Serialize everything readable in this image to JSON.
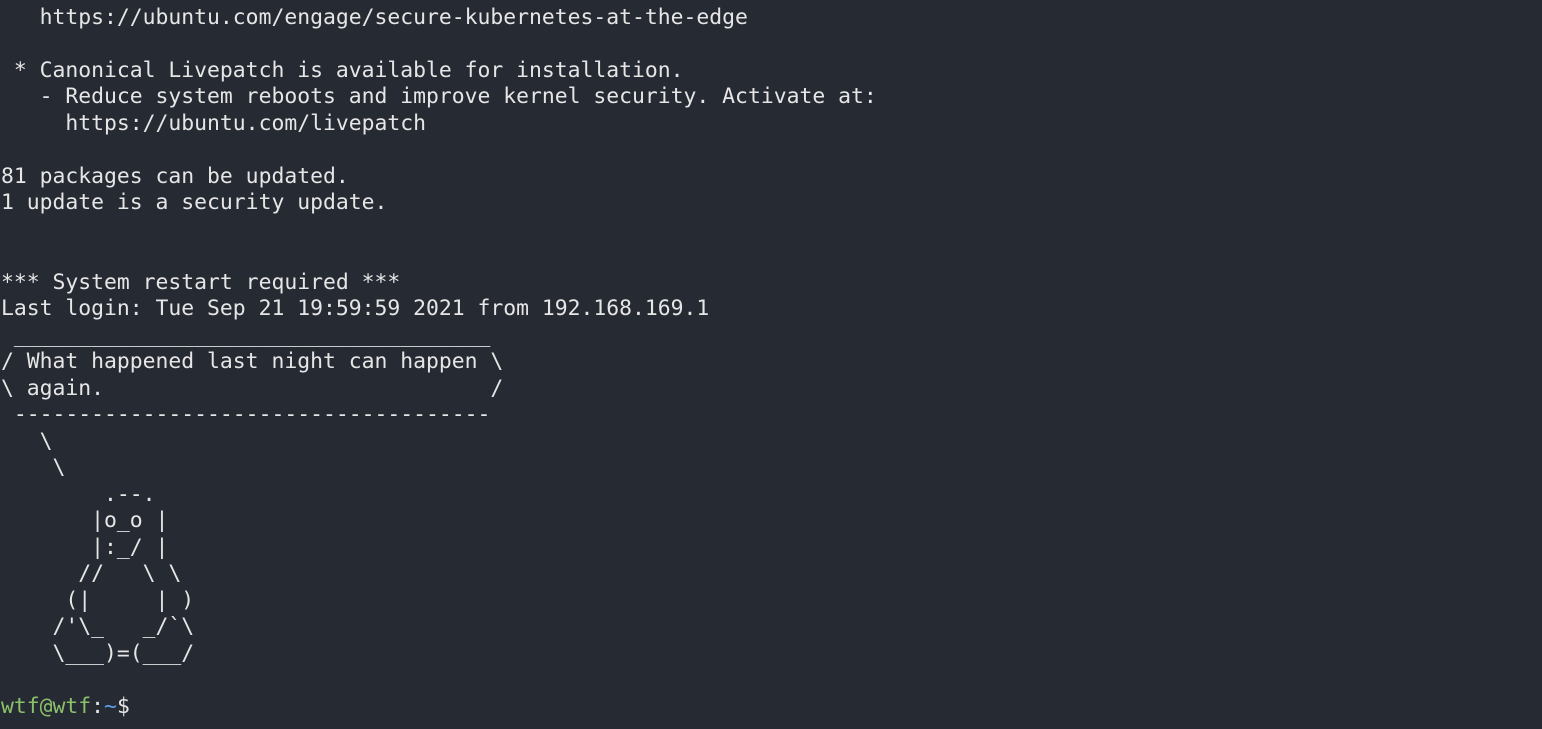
{
  "terminal": {
    "lines": [
      "   https://ubuntu.com/engage/secure-kubernetes-at-the-edge",
      "",
      " * Canonical Livepatch is available for installation.",
      "   - Reduce system reboots and improve kernel security. Activate at:",
      "     https://ubuntu.com/livepatch",
      "",
      "81 packages can be updated.",
      "1 update is a security update.",
      "",
      "",
      "*** System restart required ***",
      "Last login: Tue Sep 21 19:59:59 2021 from 192.168.169.1",
      " _____________________________________",
      "/ What happened last night can happen \\",
      "\\ again.                              /",
      " -------------------------------------",
      "   \\",
      "    \\",
      "        .--.",
      "       |o_o |",
      "       |:_/ |",
      "      //   \\ \\",
      "     (|     | )",
      "    /'\\_   _/`\\",
      "    \\___)=(___/",
      ""
    ],
    "prompt": {
      "user_host": "wtf@wtf",
      "separator": ":",
      "path": "~",
      "symbol": "$"
    }
  },
  "colors": {
    "background": "#262a33",
    "text": "#e6e6e6",
    "prompt_user": "#8ac06a",
    "prompt_path": "#5aa0e8"
  }
}
